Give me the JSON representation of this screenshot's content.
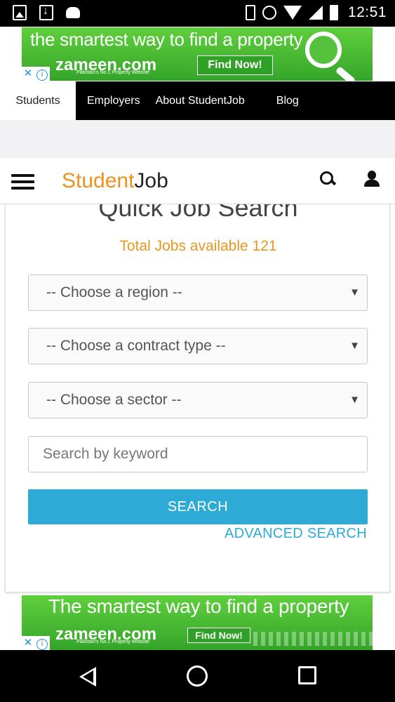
{
  "status_bar": {
    "time": "12:51",
    "icons": [
      "gallery-icon",
      "download-icon",
      "android-icon",
      "vibrate-icon",
      "alarm-icon",
      "wifi-icon",
      "signal-icon",
      "battery-icon"
    ]
  },
  "ad_top": {
    "headline": "the smartest way to find a property",
    "logo": "zameen.com",
    "tagline": "Pakistan's No.1 Property Website",
    "cta": "Find Now!",
    "close": "✕",
    "info": "i"
  },
  "ad_bottom": {
    "headline": "The smartest way to find a property",
    "logo": "zameen.com",
    "tagline": "Pakistan's No.1 Property Website",
    "cta": "Find Now!",
    "close": "✕",
    "info": "i"
  },
  "top_nav": {
    "items": [
      {
        "label": "Students",
        "active": true
      },
      {
        "label": "Employers"
      },
      {
        "label": "About StudentJob"
      },
      {
        "label": "Blog"
      }
    ]
  },
  "header": {
    "brand_part1": "Student",
    "brand_part2": "Job"
  },
  "search_form": {
    "title": "Quick Job Search",
    "total_jobs": "Total Jobs available 121",
    "region_select": "-- Choose a region --",
    "contract_select": "-- Choose a contract type --",
    "sector_select": "-- Choose a sector --",
    "keyword_placeholder": "Search by keyword",
    "search_button": "SEARCH",
    "advanced_link": "ADVANCED SEARCH",
    "caret": "▼"
  },
  "colors": {
    "brand_orange": "#f0901e",
    "accent_blue": "#2eaad6",
    "ad_green": "#35a52a",
    "nav_black": "#000000"
  }
}
